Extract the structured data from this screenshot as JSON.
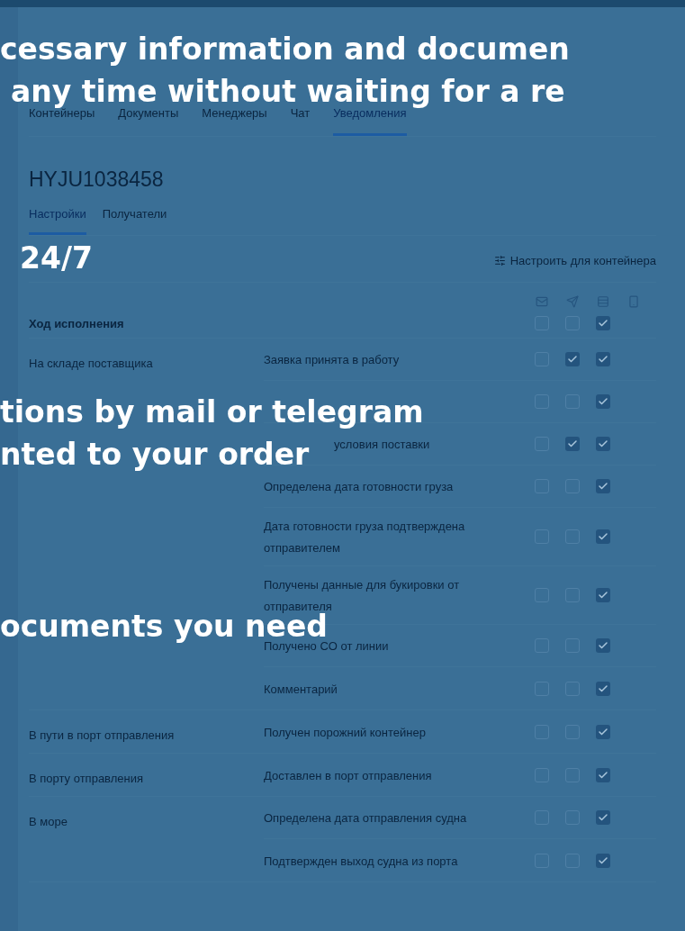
{
  "tabs": [
    {
      "label": "Контейнеры",
      "selected": false
    },
    {
      "label": "Документы",
      "selected": false
    },
    {
      "label": "Менеджеры",
      "selected": false
    },
    {
      "label": "Чат",
      "selected": false
    },
    {
      "label": "Уведомления",
      "selected": true
    }
  ],
  "container": {
    "title": "HYJU1038458"
  },
  "subtabs": [
    {
      "label": "Настройки",
      "selected": true
    },
    {
      "label": "Получатели",
      "selected": false
    }
  ],
  "configure_button": "Настроить для контейнера",
  "progress": {
    "label": "Ход исполнения",
    "email": false,
    "telegram": false,
    "web": true
  },
  "stages": [
    {
      "name": "На складе поставщика",
      "events": [
        {
          "label": "Заявка принята в работу",
          "email": false,
          "telegram": true,
          "web": true
        },
        {
          "kind": "covered",
          "email": false,
          "telegram": false,
          "web": true
        },
        {
          "label": "условия поставки",
          "kind": "partial",
          "email": false,
          "telegram": true,
          "web": true
        },
        {
          "label": "Определена дата готовности груза",
          "email": false,
          "telegram": false,
          "web": true
        },
        {
          "label": "Дата готовности груза подтверждена отправителем",
          "email": false,
          "telegram": false,
          "web": true
        },
        {
          "label": "Получены данные для букировки от отправителя",
          "email": false,
          "telegram": false,
          "web": true
        },
        {
          "label": "Получено CO от линии",
          "email": false,
          "telegram": false,
          "web": true
        },
        {
          "label": "Комментарий",
          "email": false,
          "telegram": false,
          "web": true
        }
      ]
    },
    {
      "name": "В пути в порт отправления",
      "events": [
        {
          "label": "Получен порожний контейнер",
          "email": false,
          "telegram": false,
          "web": true
        }
      ]
    },
    {
      "name": "В порту отправления",
      "events": [
        {
          "label": "Доставлен в порт отправления",
          "email": false,
          "telegram": false,
          "web": true
        }
      ]
    },
    {
      "name": "В море",
      "events": [
        {
          "label": "Определена дата отправления судна",
          "email": false,
          "telegram": false,
          "web": true
        },
        {
          "label": "Подтвержден выход судна из порта",
          "email": false,
          "telegram": false,
          "web": true
        }
      ]
    }
  ],
  "headline": [
    "cessary information and documen",
    "any time without waiting for a re",
    "24/7",
    "tions by mail or telegram",
    "nted to your order",
    "ocuments you need"
  ]
}
